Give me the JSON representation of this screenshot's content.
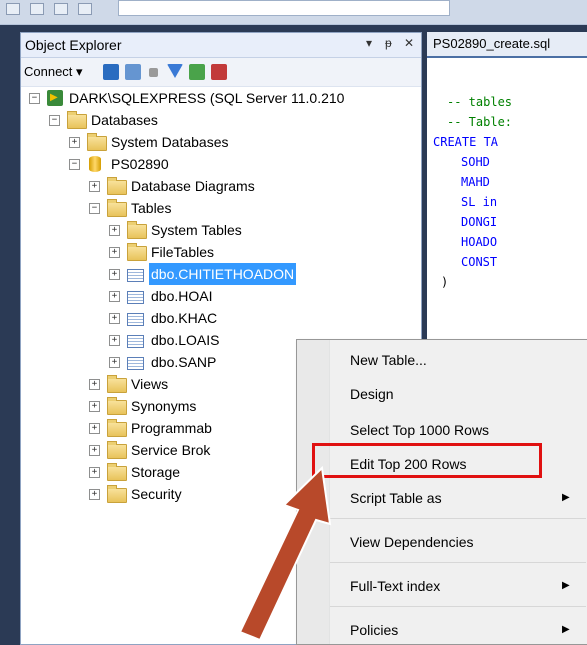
{
  "object_explorer": {
    "title": "Object Explorer",
    "title_controls": [
      "▾",
      "ᵽ",
      "✕"
    ],
    "connect_label": "Connect ▾"
  },
  "tree": {
    "server": "DARK\\SQLEXPRESS (SQL Server 11.0.210",
    "databases": "Databases",
    "system_databases": "System Databases",
    "db": "PS02890",
    "database_diagrams": "Database Diagrams",
    "tables": "Tables",
    "system_tables": "System Tables",
    "filetables": "FileTables",
    "table_items": [
      "dbo.CHITIETHOADON",
      "dbo.HOAI",
      "dbo.KHAC",
      "dbo.LOAIS",
      "dbo.SANP"
    ],
    "views": "Views",
    "synonyms": "Synonyms",
    "programmability": "Programmab",
    "service_broker": "Service Brok",
    "storage": "Storage",
    "security": "Security"
  },
  "editor": {
    "tab": "PS02890_create.sql",
    "lines": [
      "-- tables",
      "-- Table:",
      "CREATE TA",
      "SOHD",
      "MAHD",
      "SL in",
      "DONGI",
      "HOADO",
      "CONST",
      ")"
    ]
  },
  "context_menu": {
    "items": [
      {
        "label": "New Table..."
      },
      {
        "label": "Design"
      },
      {
        "label": "Select Top 1000 Rows"
      },
      {
        "label": "Edit Top 200 Rows"
      },
      {
        "label": "Script Table as",
        "arrow": "▶"
      },
      {
        "label": "View Dependencies"
      },
      {
        "label": "Full-Text index",
        "arrow": "▶"
      },
      {
        "label": "Policies",
        "arrow": "▶"
      }
    ]
  },
  "colors": {
    "selection": "#3399ff",
    "highlight_box": "#e01010",
    "arrow": "#b8492a"
  }
}
